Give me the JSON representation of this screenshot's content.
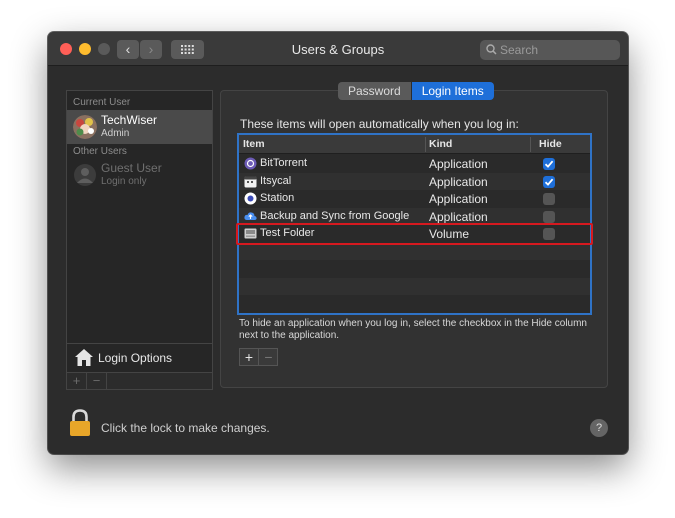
{
  "window": {
    "title": "Users & Groups",
    "search": {
      "placeholder": "Search",
      "value": ""
    }
  },
  "sidebar": {
    "current_user_header": "Current User",
    "current_user": {
      "name": "TechWiser",
      "role": "Admin"
    },
    "other_users_header": "Other Users",
    "guest_user": {
      "name": "Guest User",
      "role": "Login only"
    },
    "login_options_label": "Login Options",
    "add_label": "+",
    "remove_label": "−"
  },
  "tabs": [
    {
      "label": "Password",
      "active": false
    },
    {
      "label": "Login Items",
      "active": true
    }
  ],
  "main": {
    "intro": "These items will open automatically when you log in:",
    "columns": {
      "item": "Item",
      "kind": "Kind",
      "hide": "Hide"
    },
    "rows": [
      {
        "name": "BitTorrent",
        "kind": "Application",
        "hide": true,
        "icon": "bittorrent-icon"
      },
      {
        "name": "Itsycal",
        "kind": "Application",
        "hide": true,
        "icon": "itsycal-icon"
      },
      {
        "name": "Station",
        "kind": "Application",
        "hide": false,
        "icon": "station-icon"
      },
      {
        "name": "Backup and Sync from Google",
        "kind": "Application",
        "hide": false,
        "icon": "backup-sync-icon"
      },
      {
        "name": "Test Folder",
        "kind": "Volume",
        "hide": false,
        "icon": "volume-icon"
      }
    ],
    "help_text": "To hide an application when you log in, select the checkbox in the Hide column next to the application.",
    "add_label": "+",
    "remove_label": "−"
  },
  "footer": {
    "lock_text": "Click the lock to make changes.",
    "help_label": "?"
  },
  "colors": {
    "accent": "#1e6fd9",
    "highlight_box": "#d6191f",
    "table_border": "#2f73c7"
  }
}
